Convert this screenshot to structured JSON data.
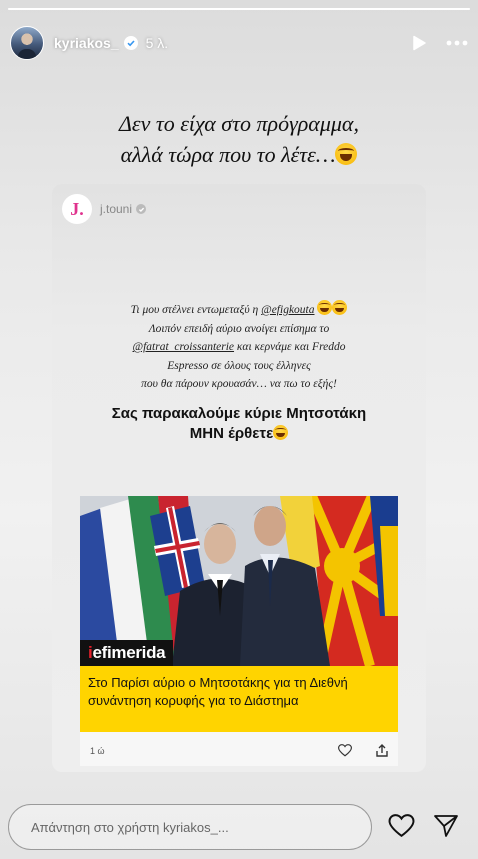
{
  "story": {
    "progress": 0.999,
    "username": "kyriakos_",
    "time": "5 λ.",
    "caption_line1": "Δεν το είχα στο πρόγραμμα,",
    "caption_line2": "αλλά τώρα που το λέτε…"
  },
  "shared_post": {
    "logo_letter": "J.",
    "username": "j.touni",
    "body_line1_pre": "Τι μου στέλνει εντωμεταξύ η ",
    "mention1": "@efigkouta",
    "body_line2": "Λοιπόν επειδή αύριο ανοίγει επίσημα το",
    "mention2": "@fatrat_croissanterie",
    "body_line3_post": " και κερνάμε και Freddo",
    "body_line4": "Espresso σε όλους τους έλληνες",
    "body_line5": "που θα πάρουν κρουασάν… να πω το εξής!",
    "title_line1": "Σας παρακαλούμε κύριε Μητσοτάκη",
    "title_line2": "ΜΗΝ έρθετε"
  },
  "article": {
    "source_prefix": "i",
    "source_rest": "efimerida",
    "headline": "Στο Παρίσι αύριο ο Μητσοτάκης για τη Διεθνή συνάντηση κορυφής για το Διάστημα",
    "age": "1 ώ"
  },
  "reply": {
    "placeholder": "Απάντηση στο χρήστη kyriakos_..."
  },
  "icons": {
    "play": "play-icon",
    "more": "more-icon",
    "heart": "heart-icon",
    "send": "send-icon",
    "share": "share-icon",
    "verified": "verified-badge-icon"
  },
  "colors": {
    "article_banner": "#ffd400",
    "source_accent": "#e3202b",
    "logo_pink": "#e0338e"
  }
}
